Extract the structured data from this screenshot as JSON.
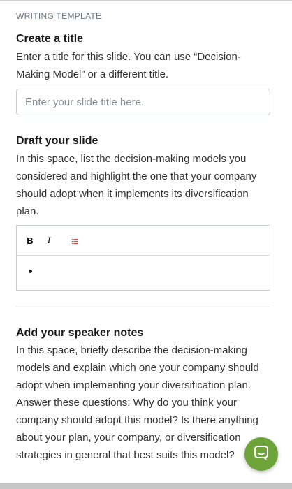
{
  "section_label": "WRITING TEMPLATE",
  "title_section": {
    "heading": "Create a title",
    "description": "Enter a title for this slide. You can use “Decision-Making Model” or a different title.",
    "input_placeholder": "Enter your slide title here.",
    "input_value": ""
  },
  "draft_section": {
    "heading": "Draft your slide",
    "description": "In this space, list the decision-making models you considered and highlight the one that your company should adopt when it implements its diversification plan.",
    "toolbar": {
      "bold_label": "B",
      "italic_label": "I",
      "list_icon": "bulleted-list-icon",
      "list_icon_color": "#e8473c"
    }
  },
  "notes_section": {
    "heading": "Add your speaker notes",
    "description": "In this space, briefly describe the decision-making models and explain which one your company should adopt when implementing your diversification plan. Answer these questions: Why do you think your company should adopt this model? Is there anything about your plan, your company, or diversification strategies in general that best suits this model?"
  },
  "chat_button": {
    "icon": "chat-bubble-icon",
    "color": "#6ea33a"
  }
}
